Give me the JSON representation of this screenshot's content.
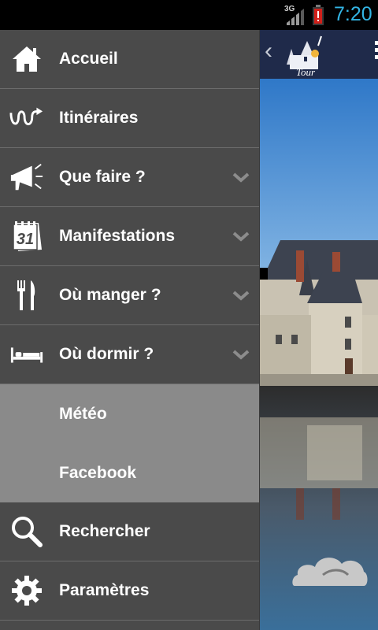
{
  "status_bar": {
    "network": "3G",
    "time": "7:20",
    "battery_color": "#d0201a",
    "clock_color": "#33b5e5"
  },
  "app": {
    "back_glyph": "‹",
    "logo_text": "Tour"
  },
  "menu": {
    "items": [
      {
        "label": "Accueil",
        "icon": "home-icon",
        "expandable": false
      },
      {
        "label": "Itinéraires",
        "icon": "route-icon",
        "expandable": false
      },
      {
        "label": "Que faire ?",
        "icon": "megaphone-icon",
        "expandable": true
      },
      {
        "label": "Manifestations",
        "icon": "calendar-icon",
        "calendar_day": "31",
        "expandable": true
      },
      {
        "label": "Où manger ?",
        "icon": "fork-knife-icon",
        "expandable": true
      },
      {
        "label": "Où dormir ?",
        "icon": "bed-icon",
        "expandable": true
      }
    ],
    "sub_items": [
      {
        "label": "Météo"
      },
      {
        "label": "Facebook"
      }
    ],
    "bottom_items": [
      {
        "label": "Rechercher",
        "icon": "search-icon"
      },
      {
        "label": "Paramètres",
        "icon": "gear-icon"
      }
    ]
  },
  "colors": {
    "drawer_bg": "#4a4a4a",
    "subgroup_bg": "#8a8a8a",
    "divider": "#6c6c6c",
    "header_bg": "#1f2a4a"
  }
}
